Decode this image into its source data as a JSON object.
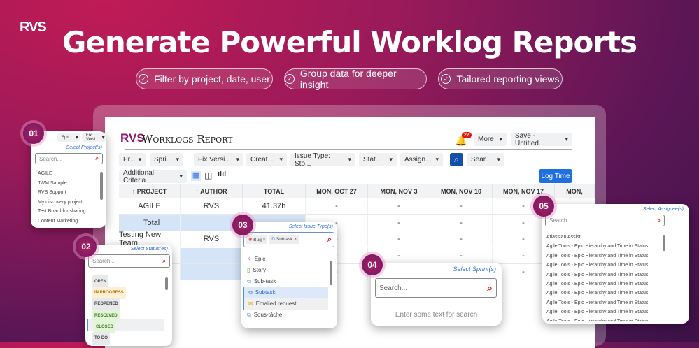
{
  "logo": "RVS",
  "title": "Generate Powerful Worklog Reports",
  "pills": [
    "Filter by project, date, user",
    "Group data for deeper insight",
    "Tailored reporting views"
  ],
  "app": {
    "logo": "RVS",
    "title": "Worklogs Report",
    "notif_count": "22",
    "more": "More",
    "save": "Save - Untitled...",
    "filters": [
      "Pr...",
      "Spri...",
      "Fix Versi...",
      "Creat...",
      "Issue Type: Sto...",
      "Stat...",
      "Assign...",
      "Sear..."
    ],
    "additional": "Additional Criteria",
    "log_time": "Log Time",
    "columns": [
      "↑ PROJECT",
      "↑ AUTHOR",
      "TOTAL",
      "MON, OCT 27",
      "MON, NOV 3",
      "MON, NOV 10",
      "MON, NOV 17",
      "MON,"
    ],
    "rows": [
      {
        "project": "AGILE",
        "author": "RVS",
        "total": "41.37h",
        "cells": [
          "-",
          "-",
          "-",
          "-"
        ]
      },
      {
        "project": "Total",
        "author": "",
        "total": "",
        "cells": [
          "-",
          "-",
          "-",
          "-"
        ]
      },
      {
        "project": "Testing New Team",
        "author": "RVS",
        "total": "",
        "cells": [
          "-",
          "-",
          "-",
          "-"
        ]
      },
      {
        "project": "",
        "author": "",
        "total": "",
        "cells": [
          "-",
          "-",
          "-",
          "-"
        ]
      },
      {
        "project": "",
        "author": "",
        "total": "",
        "cells": [
          "-",
          "-",
          "-",
          "-"
        ]
      }
    ]
  },
  "pop1": {
    "num": "01",
    "buttons": [
      "Spri...",
      "Fix Versi..."
    ],
    "label": "Select Project(s)",
    "placeholder": "Search...",
    "items": [
      "AGILE",
      "JWM Sample",
      "RVS Support",
      "My discovery project",
      "Test Board for sharing",
      "Content Marketing"
    ]
  },
  "pop2": {
    "num": "02",
    "label": "Select Status(es)",
    "placeholder": "Search...",
    "items": [
      {
        "t": "OPEN",
        "bg": "#e8e9eb",
        "c": "#444"
      },
      {
        "t": "IN PROGRESS",
        "bg": "#fdf0d5",
        "c": "#b36b00"
      },
      {
        "t": "REOPENED",
        "bg": "#e8e9eb",
        "c": "#444"
      },
      {
        "t": "RESOLVED",
        "bg": "#e3f5d8",
        "c": "#3f7d20"
      },
      {
        "t": "CLOSED",
        "bg": "#e3f5d8",
        "c": "#3f7d20"
      },
      {
        "t": "TO DO",
        "bg": "#e8e9eb",
        "c": "#444"
      }
    ]
  },
  "pop3": {
    "num": "03",
    "label": "Select Issue Type(s)",
    "chips": [
      "Bug",
      "Subtask"
    ],
    "items": [
      {
        "t": "Epic",
        "i": "✧",
        "c": "#9b5de5"
      },
      {
        "t": "Story",
        "i": "▯",
        "c": "#5aa02c"
      },
      {
        "t": "Sub-task",
        "i": "⧉",
        "c": "#4a8fe0"
      },
      {
        "t": "Subtask",
        "i": "⧉",
        "c": "#4a8fe0"
      },
      {
        "t": "Emailed request",
        "i": "✉",
        "c": "#f0a000"
      },
      {
        "t": "Sous-tâche",
        "i": "⧉",
        "c": "#4a8fe0"
      }
    ]
  },
  "pop4": {
    "num": "04",
    "label": "Select Sprint(s)",
    "placeholder": "Search...",
    "empty": "Enter some text for search"
  },
  "pop5": {
    "num": "05",
    "label": "Select Assignee(s)",
    "placeholder": "Search...",
    "items": [
      "Atlassian Assist",
      "Agile Tools - Epic Hierarchy and Time in Status",
      "Agile Tools - Epic Hierarchy and Time in Status",
      "Agile Tools - Epic Hierarchy and Time in Status",
      "Agile Tools - Epic Hierarchy and Time in Status",
      "Agile Tools - Epic Hierarchy and Time in Status",
      "Agile Tools - Epic Hierarchy and Time in Status",
      "Agile Tools - Epic Hierarchy and Time in Status",
      "Agile Tools - Epic Hierarchy and Time in Status",
      "Agile Tools - Epic Hierarchy and Time in Status"
    ]
  }
}
